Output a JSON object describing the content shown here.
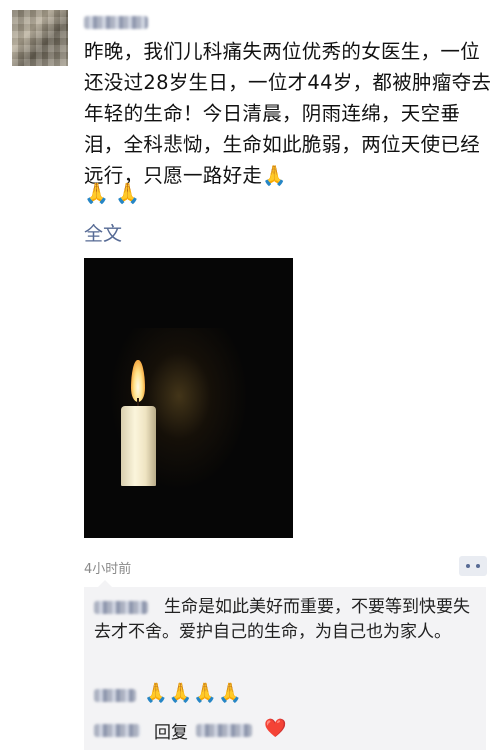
{
  "post": {
    "text": "昨晚，我们儿科痛失两位优秀的女医生，一位还没过28岁生日，一位才44岁，都被肿瘤夺去年轻的生命！今日清晨，阴雨连绵，天空垂泪，全科悲恸，生命如此脆弱，两位天使已经远行，只愿一路好走🙏",
    "trailing_emoji": "🙏 🙏",
    "fold_link": "全文",
    "timestamp": "4小时前",
    "image_icon": "candle-photo"
  },
  "comments": [
    {
      "text": "生命是如此美好而重要，不要等到快要失去才不舍。爱护自己的生命，为自己也为家人。"
    },
    {
      "text": "🙏🙏🙏🙏"
    },
    {
      "reply_label": "回复",
      "text": "❤️"
    }
  ],
  "colors": {
    "link": "#576b95",
    "comment_bg": "#f3f3f5",
    "timestamp": "#8a8a8a"
  },
  "icons": {
    "comment_button": "more-dots-icon"
  }
}
